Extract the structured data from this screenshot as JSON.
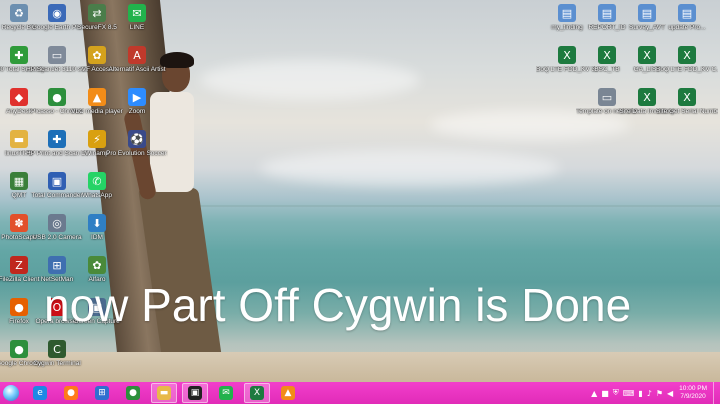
{
  "desktop": {
    "caption": "now Part Off Cygwin is Done",
    "icons_left": [
      {
        "label": "Recycle Bin",
        "icon": "recycle-bin-icon",
        "color": "#6c8fb0",
        "glyph": "♻"
      },
      {
        "label": "Google Earth Pro",
        "icon": "google-earth-icon",
        "color": "#3b6ab8",
        "glyph": "◉"
      },
      {
        "label": "SecureFX 8.5",
        "icon": "securefx-icon",
        "color": "#4a7d4a",
        "glyph": "⇄"
      },
      {
        "label": "LINE",
        "icon": "line-icon",
        "color": "#22b24c",
        "glyph": "✉"
      },
      {
        "label": "360 Total Security",
        "icon": "security-icon",
        "color": "#2f9b3a",
        "glyph": "✚"
      },
      {
        "label": "HP ScanJet 3110 series",
        "icon": "scanner-icon",
        "color": "#7f8a99",
        "glyph": "▭"
      },
      {
        "label": "VF Access",
        "icon": "vf-access-icon",
        "color": "#d4a21d",
        "glyph": "✿"
      },
      {
        "label": "Alternatif Ascii Artist",
        "icon": "ascii-artist-icon",
        "color": "#c0392b",
        "glyph": "A"
      },
      {
        "label": "AnyDesk",
        "icon": "anydesk-icon",
        "color": "#e0312d",
        "glyph": "◆"
      },
      {
        "label": "Picasso - Chrome",
        "icon": "chrome-icon",
        "color": "#2d8f3c",
        "glyph": "●"
      },
      {
        "label": "VLC media player",
        "icon": "vlc-icon",
        "color": "#f28c18",
        "glyph": "▲"
      },
      {
        "label": "Zoom",
        "icon": "zoom-icon",
        "color": "#2d8cff",
        "glyph": "▶"
      },
      {
        "label": "linuxTIPS",
        "icon": "folder-icon",
        "color": "#e3b341",
        "glyph": "▬"
      },
      {
        "label": "HP Print and Scan Doctor",
        "icon": "hp-doctor-icon",
        "color": "#1d6fb8",
        "glyph": "✚"
      },
      {
        "label": "Winamp",
        "icon": "winamp-icon",
        "color": "#d9a010",
        "glyph": "⚡"
      },
      {
        "label": "Pro Evolution Soccer 2013",
        "icon": "pes-icon",
        "color": "#3a4a8a",
        "glyph": "⚽"
      },
      {
        "label": "QMT",
        "icon": "qmt-icon",
        "color": "#3a7f3a",
        "glyph": "▦"
      },
      {
        "label": "Total Commander",
        "icon": "total-commander-icon",
        "color": "#2f5fb3",
        "glyph": "▣"
      },
      {
        "label": "WhatsApp",
        "icon": "whatsapp-icon",
        "color": "#25d366",
        "glyph": "✆"
      },
      {
        "label": "PhotoScape",
        "icon": "photoscape-icon",
        "color": "#e2502b",
        "glyph": "✽"
      },
      {
        "label": "USB 2.0 Camera",
        "icon": "camera-icon",
        "color": "#6b7a8f",
        "glyph": "◎"
      },
      {
        "label": "IDM",
        "icon": "idm-icon",
        "color": "#2f7fc4",
        "glyph": "⬇"
      },
      {
        "label": "FileZilla Client",
        "icon": "filezilla-icon",
        "color": "#c0271e",
        "glyph": "Z"
      },
      {
        "label": "NetSetMan",
        "icon": "netsetman-icon",
        "color": "#3f6fb0",
        "glyph": "⊞"
      },
      {
        "label": "Alfaro",
        "icon": "alfaro-icon",
        "color": "#4a8a3a",
        "glyph": "✿"
      },
      {
        "label": "Firefox",
        "icon": "firefox-icon",
        "color": "#e66000",
        "glyph": "●"
      },
      {
        "label": "Opera browser",
        "icon": "opera-icon",
        "color": "#cc0f16",
        "glyph": "O"
      },
      {
        "label": "Screen Capture",
        "icon": "screen-capture-icon",
        "color": "#4b6b8f",
        "glyph": "▣"
      },
      {
        "label": "Google Chrome",
        "icon": "chrome-icon",
        "color": "#2d8f3c",
        "glyph": "●"
      },
      {
        "label": "Cygwin Terminal",
        "icon": "cygwin-icon",
        "color": "#2f5a2f",
        "glyph": "C"
      }
    ],
    "icons_right": [
      {
        "label": "my_finding",
        "icon": "document-icon",
        "color": "#5b8fd0",
        "glyph": "▤"
      },
      {
        "label": "REPORT_ID",
        "icon": "document-icon",
        "color": "#5b8fd0",
        "glyph": "▤"
      },
      {
        "label": "Survey_AVT",
        "icon": "document-icon",
        "color": "#5b8fd0",
        "glyph": "▤"
      },
      {
        "label": "update Pro...",
        "icon": "document-icon",
        "color": "#5b8fd0",
        "glyph": "▤"
      },
      {
        "label": "BoQ LTE FDD_KV 3...",
        "icon": "excel-icon",
        "color": "#1d7a3f",
        "glyph": "X"
      },
      {
        "label": "BSC_TB",
        "icon": "excel-icon",
        "color": "#1d7a3f",
        "glyph": "X"
      },
      {
        "label": "GA_LIST",
        "icon": "excel-icon",
        "color": "#1d7a3f",
        "glyph": "X"
      },
      {
        "label": "BoQ LTE FDD_KV C...",
        "icon": "excel-icon",
        "color": "#1d7a3f",
        "glyph": "X"
      },
      {
        "label": "Template on new site J...",
        "icon": "template-icon",
        "color": "#7a8694",
        "glyph": "▭"
      },
      {
        "label": "Site Data Inventory",
        "icon": "excel-icon",
        "color": "#1d7a3f",
        "glyph": "X"
      },
      {
        "label": "Site Get Serial Number Up...",
        "icon": "excel-icon",
        "color": "#1d7a3f",
        "glyph": "X"
      }
    ]
  },
  "taskbar": {
    "background": "#e12bb8",
    "pinned": [
      {
        "name": "internet-explorer-icon",
        "glyph": "e",
        "color": "#1e88e5",
        "active": false
      },
      {
        "name": "firefox-icon",
        "glyph": "●",
        "color": "#ff7a1a",
        "active": false
      },
      {
        "name": "network-icon",
        "glyph": "⊞",
        "color": "#2f6fd0",
        "active": false
      },
      {
        "name": "chrome-icon",
        "glyph": "●",
        "color": "#2d8f3c",
        "active": false
      },
      {
        "name": "file-explorer-icon",
        "glyph": "▬",
        "color": "#e8b94a",
        "active": true
      },
      {
        "name": "terminal-icon",
        "glyph": "▣",
        "color": "#222222",
        "active": true
      },
      {
        "name": "line-icon",
        "glyph": "✉",
        "color": "#22b24c",
        "active": false
      },
      {
        "name": "excel-icon",
        "glyph": "X",
        "color": "#1d7a3f",
        "active": true
      },
      {
        "name": "vlc-icon",
        "glyph": "▲",
        "color": "#f28c18",
        "active": false
      }
    ],
    "tray_icons": [
      "chevron-up-icon",
      "red-app-icon",
      "shield-icon",
      "keyboard-icon",
      "network-tray-icon",
      "volume-icon",
      "flag-icon",
      "speaker-icon"
    ],
    "clock_time": "10:00 PM",
    "clock_date": "7/9/2020"
  }
}
